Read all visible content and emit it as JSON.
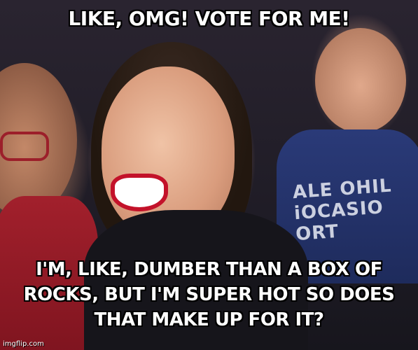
{
  "meme": {
    "top_text": "LIKE, OMG! VOTE FOR ME!",
    "bottom_text": "I'M, LIKE, DUMBER THAN A BOX OF ROCKS, BUT I'M SUPER HOT SO DOES THAT MAKE UP FOR IT?",
    "watermark": "imgflip.com"
  },
  "photo": {
    "shirt_text": [
      "ALE  OHIL",
      "iOCASIO",
      "ORT"
    ]
  }
}
